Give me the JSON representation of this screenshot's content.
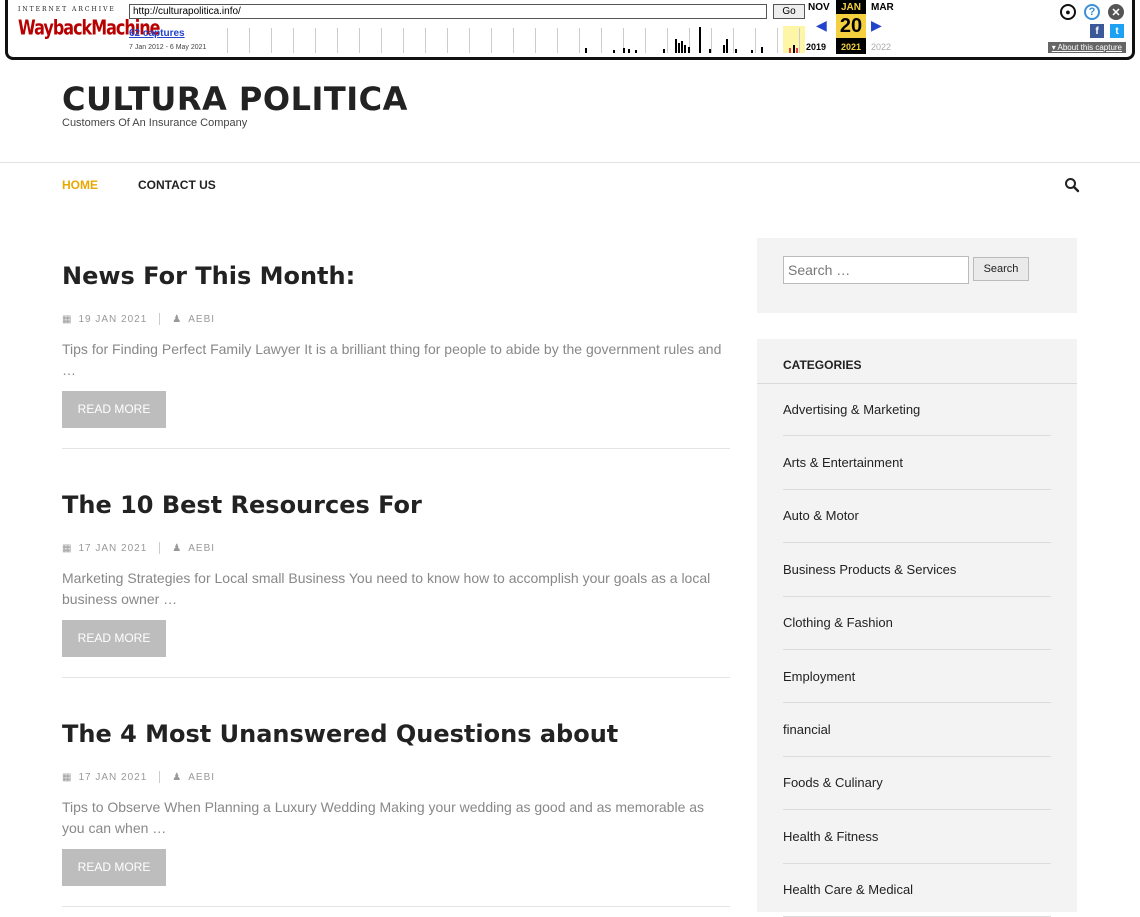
{
  "wayback": {
    "logo_top": "INTERNET ARCHIVE",
    "logo_main": "WaybackMachine",
    "url": "http://culturapolitica.info/",
    "go_label": "Go",
    "captures": "62 captures",
    "date_range": "7 Jan 2012 - 6 May 2021",
    "prev_month": "NOV",
    "cur_month": "JAN",
    "next_month": "MAR",
    "cur_day": "20",
    "prev_year": "2019",
    "cur_year": "2021",
    "next_year": "2022",
    "about": "About this capture",
    "facebook": "f",
    "twitter": "t"
  },
  "site": {
    "title": "CULTURA POLITICA",
    "tagline": "Customers Of An Insurance Company"
  },
  "nav": {
    "items": [
      {
        "label": "HOME"
      },
      {
        "label": "CONTACT US"
      }
    ]
  },
  "posts": [
    {
      "title": "News For This Month:",
      "date": "19 JAN 2021",
      "author": "AEBI",
      "excerpt": "Tips for Finding Perfect Family Lawyer It is a brilliant thing for people to abide by the government rules and …",
      "read_more": "READ MORE"
    },
    {
      "title": "The 10 Best Resources For",
      "date": "17 JAN 2021",
      "author": "AEBI",
      "excerpt": "Marketing Strategies for Local small Business You need to know how to accomplish your goals as a local business owner …",
      "read_more": "READ MORE"
    },
    {
      "title": "The 4 Most Unanswered Questions about",
      "date": "17 JAN 2021",
      "author": "AEBI",
      "excerpt": "Tips to Observe When Planning a Luxury Wedding Making your wedding as good and as memorable as you can when …",
      "read_more": "READ MORE"
    }
  ],
  "sidebar": {
    "search_placeholder": "Search …",
    "search_button": "Search",
    "categories_title": "CATEGORIES",
    "categories": [
      "Advertising & Marketing",
      "Arts & Entertainment",
      "Auto & Motor",
      "Business Products & Services",
      "Clothing & Fashion",
      "Employment",
      "financial",
      "Foods & Culinary",
      "Health & Fitness",
      "Health Care & Medical"
    ]
  },
  "colors": {
    "accent": "#e8a800",
    "read_more_bg": "#bdbdbd",
    "sidebar_bg": "#f3f3f3"
  }
}
